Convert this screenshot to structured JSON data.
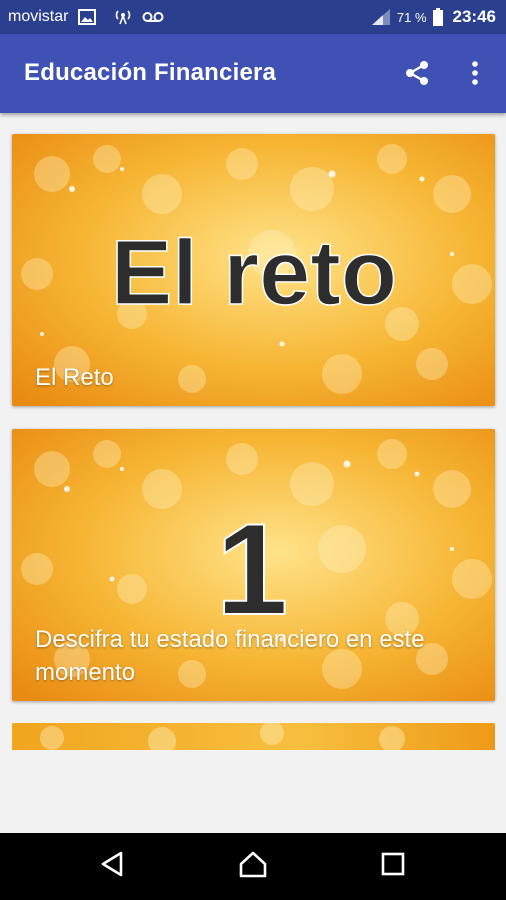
{
  "status_bar": {
    "carrier": "movistar",
    "battery_percent": "71 %",
    "time": "23:46",
    "icons": [
      "image-icon",
      "signal-tower-icon",
      "voicemail-icon",
      "cell-signal-icon",
      "battery-icon"
    ]
  },
  "app_bar": {
    "title": "Educación Financiera",
    "actions": [
      "share-icon",
      "more-vert-icon"
    ]
  },
  "cards": [
    {
      "image_text": "El reto",
      "label": "El Reto"
    },
    {
      "image_text": "1",
      "label": "Descifra tu estado financiero en este momento"
    },
    {
      "image_text": "",
      "label": ""
    }
  ],
  "nav_bar": {
    "buttons": [
      "back-icon",
      "home-icon",
      "recents-icon"
    ]
  },
  "colors": {
    "status_bar": "#2b3f8f",
    "app_bar": "#3f51b5",
    "card_gold": "#f3a81e",
    "background": "#f2f2f2",
    "nav_bar": "#000000"
  }
}
